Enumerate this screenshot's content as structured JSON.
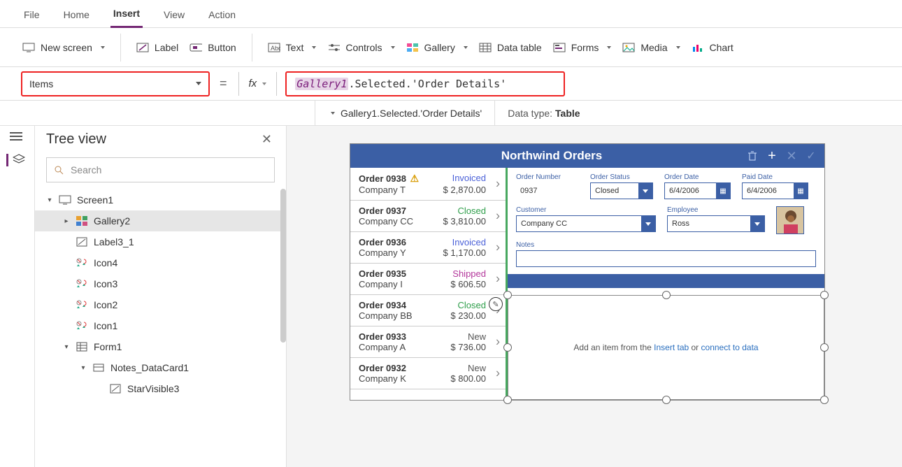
{
  "menu": {
    "items": [
      "File",
      "Home",
      "Insert",
      "View",
      "Action"
    ],
    "active": 2
  },
  "ribbon": {
    "newScreen": "New screen",
    "label": "Label",
    "button": "Button",
    "text": "Text",
    "controls": "Controls",
    "gallery": "Gallery",
    "dataTable": "Data table",
    "forms": "Forms",
    "media": "Media",
    "chart": "Chart"
  },
  "propertyDropdown": "Items",
  "formula": {
    "token1": "Gallery1",
    "rest": ".Selected.'Order Details'"
  },
  "resultBar": {
    "path": "Gallery1.Selected.'Order Details'",
    "typeLabel": "Data type:",
    "typeValue": "Table"
  },
  "treeView": {
    "title": "Tree view",
    "searchPlaceholder": "Search",
    "nodes": [
      {
        "label": "Screen1",
        "depth": 1,
        "tw": "open",
        "icon": "screen"
      },
      {
        "label": "Gallery2",
        "depth": 2,
        "tw": "closed",
        "icon": "gallery",
        "selected": true
      },
      {
        "label": "Label3_1",
        "depth": 2,
        "tw": "none",
        "icon": "label"
      },
      {
        "label": "Icon4",
        "depth": 2,
        "tw": "none",
        "icon": "iconctrl"
      },
      {
        "label": "Icon3",
        "depth": 2,
        "tw": "none",
        "icon": "iconctrl"
      },
      {
        "label": "Icon2",
        "depth": 2,
        "tw": "none",
        "icon": "iconctrl"
      },
      {
        "label": "Icon1",
        "depth": 2,
        "tw": "none",
        "icon": "iconctrl"
      },
      {
        "label": "Form1",
        "depth": 2,
        "tw": "open",
        "icon": "form"
      },
      {
        "label": "Notes_DataCard1",
        "depth": 3,
        "tw": "open",
        "icon": "datacard"
      },
      {
        "label": "StarVisible3",
        "depth": 4,
        "tw": "none",
        "icon": "label"
      }
    ]
  },
  "app": {
    "title": "Northwind Orders",
    "orders": [
      {
        "name": "Order 0938",
        "company": "Company T",
        "status": "Invoiced",
        "statusClass": "st-invoiced",
        "amount": "$ 2,870.00",
        "warn": true
      },
      {
        "name": "Order 0937",
        "company": "Company CC",
        "status": "Closed",
        "statusClass": "st-closed",
        "amount": "$ 3,810.00"
      },
      {
        "name": "Order 0936",
        "company": "Company Y",
        "status": "Invoiced",
        "statusClass": "st-invoiced",
        "amount": "$ 1,170.00"
      },
      {
        "name": "Order 0935",
        "company": "Company I",
        "status": "Shipped",
        "statusClass": "st-shipped",
        "amount": "$ 606.50"
      },
      {
        "name": "Order 0934",
        "company": "Company BB",
        "status": "Closed",
        "statusClass": "st-closed",
        "amount": "$ 230.00"
      },
      {
        "name": "Order 0933",
        "company": "Company A",
        "status": "New",
        "statusClass": "st-new",
        "amount": "$ 736.00"
      },
      {
        "name": "Order 0932",
        "company": "Company K",
        "status": "New",
        "statusClass": "st-new",
        "amount": "$ 800.00"
      }
    ],
    "form": {
      "orderNumber": {
        "label": "Order Number",
        "value": "0937"
      },
      "orderStatus": {
        "label": "Order Status",
        "value": "Closed"
      },
      "orderDate": {
        "label": "Order Date",
        "value": "6/4/2006"
      },
      "paidDate": {
        "label": "Paid Date",
        "value": "6/4/2006"
      },
      "customer": {
        "label": "Customer",
        "value": "Company CC"
      },
      "employee": {
        "label": "Employee",
        "value": "Ross"
      },
      "notes": {
        "label": "Notes"
      }
    },
    "emptyMsg": {
      "pre": "Add an item from the ",
      "link1": "Insert tab",
      "mid": " or ",
      "link2": "connect to data"
    }
  }
}
